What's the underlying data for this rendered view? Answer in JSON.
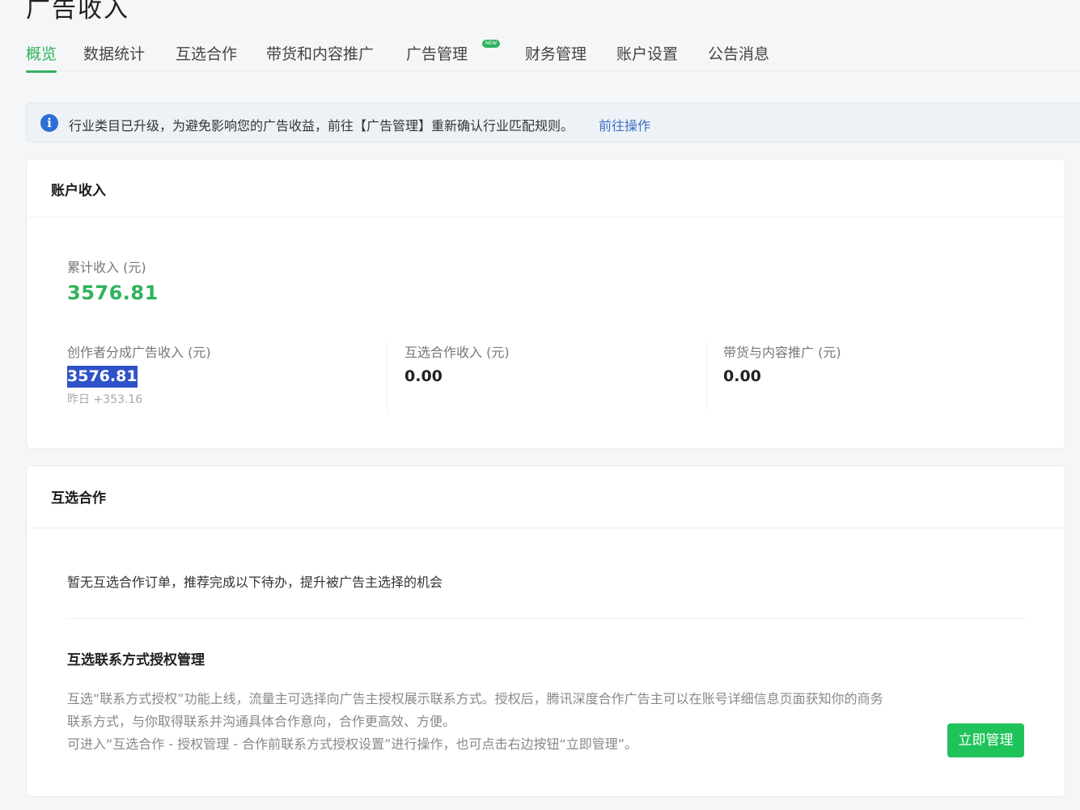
{
  "page": {
    "title": "广告收入"
  },
  "tabs": [
    {
      "label": "概览"
    },
    {
      "label": "数据统计"
    },
    {
      "label": "互选合作"
    },
    {
      "label": "带货和内容推广"
    },
    {
      "label": "广告管理",
      "badge": "NEW"
    },
    {
      "label": "财务管理"
    },
    {
      "label": "账户设置"
    },
    {
      "label": "公告消息"
    }
  ],
  "notice": {
    "text": "行业类目已升级，为避免影响您的广告收益，前往【广告管理】重新确认行业匹配规则。",
    "link": "前往操作"
  },
  "account_income": {
    "title": "账户收入",
    "total_label": "累计收入 (元)",
    "total_value": "3576.81",
    "stats": [
      {
        "label": "创作者分成广告收入 (元)",
        "value": "3576.81",
        "sub": "昨日 +353.16"
      },
      {
        "label": "互选合作收入 (元)",
        "value": "0.00"
      },
      {
        "label": "带货与内容推广 (元)",
        "value": "0.00"
      }
    ]
  },
  "mutual": {
    "title": "互选合作",
    "empty_text": "暂无互选合作订单，推荐完成以下待办，提升被广告主选择的机会",
    "section_title": "互选联系方式授权管理",
    "desc_line1": "互选“联系方式授权”功能上线，流量主可选择向广告主授权展示联系方式。授权后，腾讯深度合作广告主可以在账号详细信息页面获知你的商务",
    "desc_line2": "联系方式，与你取得联系并沟通具体合作意向，合作更高效、方便。",
    "desc_line3": "可进入“互选合作 - 授权管理 - 合作前联系方式授权设置”进行操作，也可点击右边按钮“立即管理”。",
    "button": "立即管理"
  },
  "colors": {
    "accent": "#2fb25d",
    "button": "#1fc35a",
    "link": "#3e6fc4",
    "highlight": "#2f52c9"
  },
  "icons": {
    "notice": "info-icon"
  }
}
